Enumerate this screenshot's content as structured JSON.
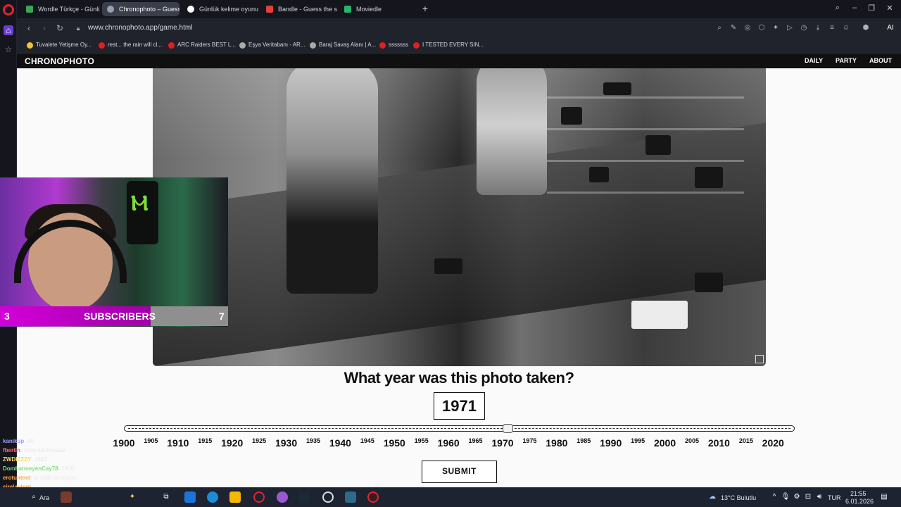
{
  "browser": {
    "tabs": [
      {
        "label": "Wordle Türkçe - Günlük K",
        "favicon_color": "#3aa655",
        "active": false
      },
      {
        "label": "Chronophoto – Guess th",
        "favicon_color": "#9aa0ad",
        "active": true
      },
      {
        "label": "Günlük kelime oyunu - pa",
        "favicon_color": "#ffffff",
        "active": false
      },
      {
        "label": "Bandle - Guess the song,",
        "favicon_color": "#e2413b",
        "active": false
      },
      {
        "label": "Moviedle",
        "favicon_color": "#27b36b",
        "active": false
      }
    ],
    "url": "www.chronophoto.app/game.html",
    "ai_label": "AI",
    "bookmarks": [
      {
        "label": "Tuvalete Yetişme Oy...",
        "color": "#f2c230"
      },
      {
        "label": "rest... the rain will cl...",
        "color": "#e02020"
      },
      {
        "label": "ARC Raiders BEST L...",
        "color": "#e02020"
      },
      {
        "label": "Eşya Veritabanı - AR...",
        "color": "#aaaaaa"
      },
      {
        "label": "Baraj Savaş Alanı | A...",
        "color": "#aaaaaa"
      },
      {
        "label": "sssssss",
        "color": "#e02020"
      },
      {
        "label": "I TESTED EVERY SIN...",
        "color": "#e02020"
      }
    ]
  },
  "site": {
    "logo": "CHRONOPHOTO",
    "nav": [
      "DAILY",
      "PARTY",
      "ABOUT"
    ],
    "question": "What year was this photo taken?",
    "selected_year": "1971",
    "slider": {
      "min": 1900,
      "max": 2024,
      "value": 1971
    },
    "major_ticks": [
      "1900",
      "1910",
      "1920",
      "1930",
      "1940",
      "1950",
      "1960",
      "1970",
      "1980",
      "1990",
      "2000",
      "2010",
      "2020"
    ],
    "minor_ticks": [
      "1905",
      "1915",
      "1925",
      "1935",
      "1945",
      "1955",
      "1965",
      "1975",
      "1985",
      "1995",
      "2005",
      "2015"
    ],
    "submit_label": "SUBMIT"
  },
  "stream_overlay": {
    "subscriber_left": "3",
    "subscriber_label": "SUBSCRIBERS",
    "subscriber_right": "7",
    "chat": [
      {
        "user": "kanikup",
        "msg": ": 80",
        "color": "#9aa0ff"
      },
      {
        "user": "fbertin",
        "msg": ": nooo katılmaaaa",
        "color": "#ff6a6a"
      },
      {
        "user": "ZWDIZZZY",
        "msg": ": 1963",
        "color": "#ffd966"
      },
      {
        "user": "DomhanneyenCay78",
        "msg": ": 1970",
        "color": "#7ee07e"
      },
      {
        "user": "erotuntent",
        "msg": ": ar nirilk versiyonu",
        "color": "#ffa94d"
      },
      {
        "user": "sirelaytent",
        "msg": "",
        "color": "#ffa94d"
      }
    ]
  },
  "taskbar": {
    "search_label": "Ara",
    "weather": "13°C  Bulutlu",
    "lang": "TUR",
    "time": "21:55",
    "date": "6.01.2026"
  }
}
